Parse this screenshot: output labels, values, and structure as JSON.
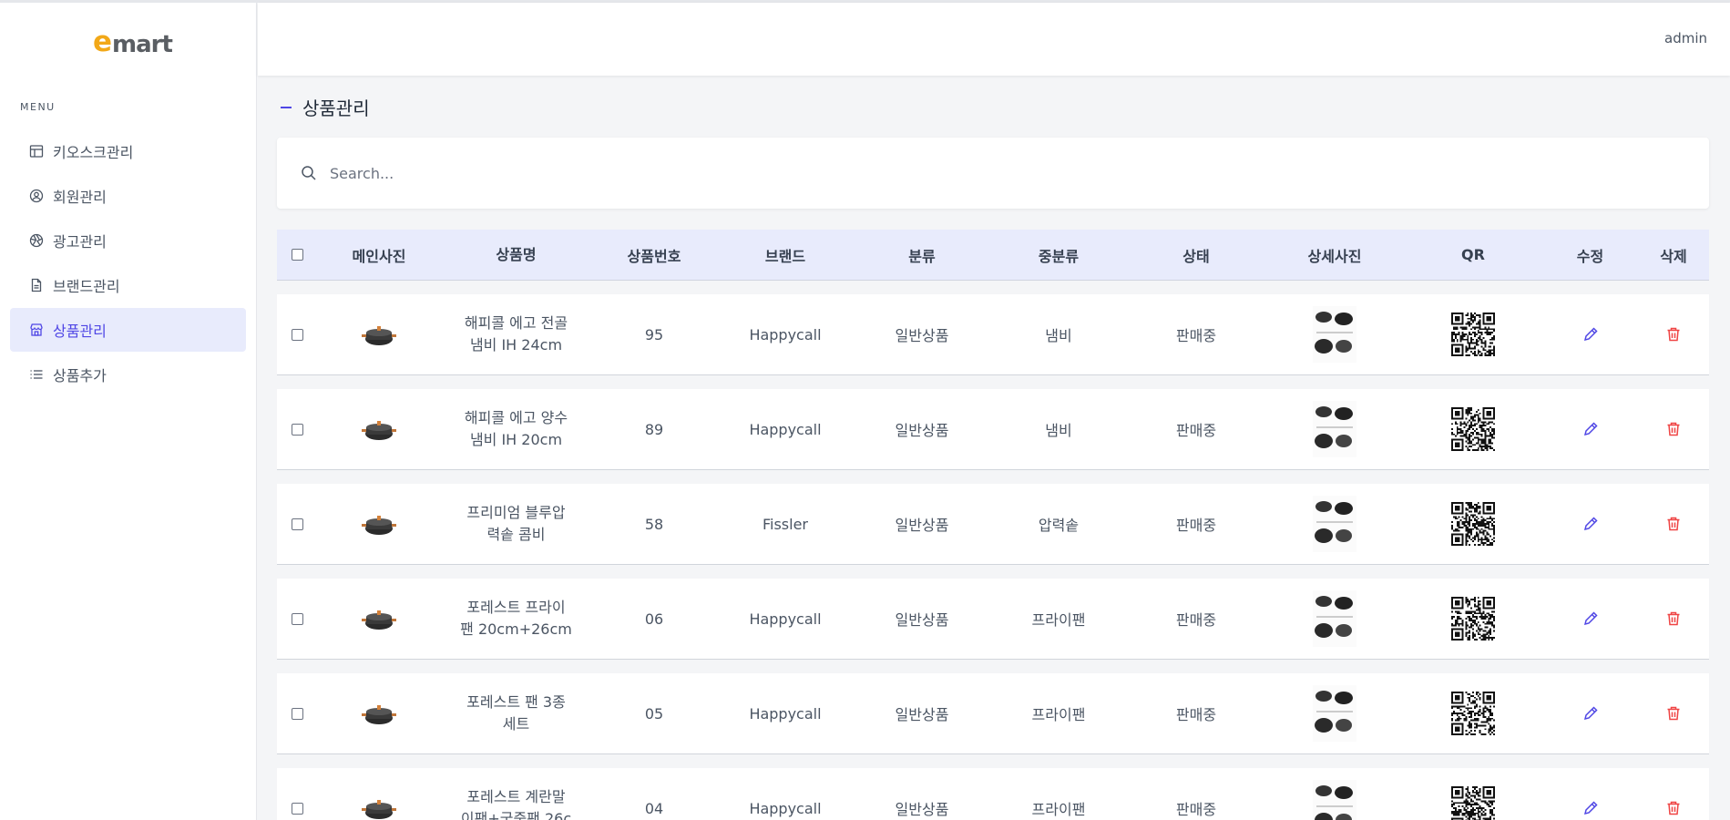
{
  "logo": {
    "e": "e",
    "rest": "mart"
  },
  "header": {
    "user": "admin"
  },
  "sidebar": {
    "menu_label": "MENU",
    "items": [
      {
        "label": "키오스크관리",
        "icon": "table-icon",
        "active": false
      },
      {
        "label": "회원관리",
        "icon": "user-circle-icon",
        "active": false
      },
      {
        "label": "광고관리",
        "icon": "aperture-icon",
        "active": false
      },
      {
        "label": "브랜드관리",
        "icon": "document-icon",
        "active": false
      },
      {
        "label": "상품관리",
        "icon": "store-icon",
        "active": true
      },
      {
        "label": "상품추가",
        "icon": "list-icon",
        "active": false
      }
    ]
  },
  "page": {
    "title": "상품관리"
  },
  "search": {
    "placeholder": "Search..."
  },
  "table": {
    "headers": [
      "메인사진",
      "상품명",
      "상품번호",
      "브랜드",
      "분류",
      "중분류",
      "상태",
      "상세사진",
      "QR",
      "수정",
      "삭제"
    ],
    "rows": [
      {
        "name_line1": "해피콜 에고 전골",
        "name_line2": "냄비 IH 24cm",
        "no": "95",
        "brand": "Happycall",
        "category": "일반상품",
        "subcategory": "냄비",
        "status": "판매중"
      },
      {
        "name_line1": "해피콜 에고 양수",
        "name_line2": "냄비 IH 20cm",
        "no": "89",
        "brand": "Happycall",
        "category": "일반상품",
        "subcategory": "냄비",
        "status": "판매중"
      },
      {
        "name_line1": "프리미엄 블루압",
        "name_line2": "력솥 콤비",
        "no": "58",
        "brand": "Fissler",
        "category": "일반상품",
        "subcategory": "압력솥",
        "status": "판매중"
      },
      {
        "name_line1": "포레스트 프라이",
        "name_line2": "팬 20cm+26cm",
        "no": "06",
        "brand": "Happycall",
        "category": "일반상품",
        "subcategory": "프라이팬",
        "status": "판매중"
      },
      {
        "name_line1": "포레스트 팬 3종",
        "name_line2": "세트",
        "no": "05",
        "brand": "Happycall",
        "category": "일반상품",
        "subcategory": "프라이팬",
        "status": "판매중"
      },
      {
        "name_line1": "포레스트 계란말",
        "name_line2": "이팬+궁중팬 26c",
        "no": "04",
        "brand": "Happycall",
        "category": "일반상품",
        "subcategory": "프라이팬",
        "status": "판매중"
      }
    ]
  },
  "colors": {
    "accent": "#4f46e5",
    "active_bg": "#e8ebfc",
    "delete": "#ef4444",
    "logo_orange": "#f2a818"
  }
}
